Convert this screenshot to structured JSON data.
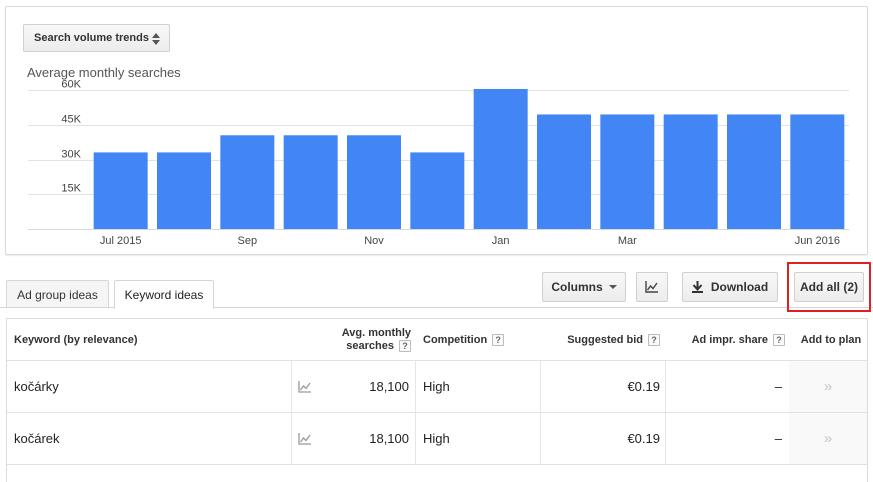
{
  "chart_card": {
    "selector_label": "Search volume trends",
    "title": "Average monthly searches"
  },
  "chart_data": {
    "type": "bar",
    "title": "Average monthly searches",
    "categories": [
      "Jul 2015",
      "Aug 2015",
      "Sep 2015",
      "Oct 2015",
      "Nov 2015",
      "Dec 2015",
      "Jan 2016",
      "Feb 2016",
      "Mar 2016",
      "Apr 2016",
      "May 2016",
      "Jun 2016"
    ],
    "x_tick_labels": [
      "Jul 2015",
      "",
      "Sep",
      "",
      "Nov",
      "",
      "Jan",
      "",
      "Mar",
      "",
      "",
      "Jun 2016"
    ],
    "values": [
      33100,
      33100,
      40500,
      40500,
      40500,
      33100,
      60500,
      49500,
      49500,
      49500,
      49500,
      49500
    ],
    "y_ticks": [
      15000,
      30000,
      45000,
      60000
    ],
    "y_tick_labels": [
      "15K",
      "30K",
      "45K",
      "60K"
    ],
    "ylim": [
      0,
      60500
    ],
    "bar_color": "#4285f4",
    "grid": true
  },
  "tabs": [
    {
      "label": "Ad group ideas",
      "active": false
    },
    {
      "label": "Keyword ideas",
      "active": true
    }
  ],
  "toolbar": {
    "columns_label": "Columns",
    "chart_icon": "line-chart-icon",
    "download_label": "Download",
    "download_icon": "download-icon",
    "add_all_label": "Add all (2)",
    "highlight_color": "#e02020"
  },
  "table": {
    "headers": {
      "keyword": "Keyword (by relevance)",
      "avg_line1": "Avg. monthly",
      "avg_line2": "searches",
      "competition": "Competition",
      "bid": "Suggested bid",
      "impr": "Ad impr. share",
      "plan": "Add to plan",
      "help": "?"
    },
    "rows": [
      {
        "keyword": "kočárky",
        "searches": "18,100",
        "competition": "High",
        "bid": "€0.19",
        "impr_share": "–",
        "plan_icon": "»"
      },
      {
        "keyword": "kočárek",
        "searches": "18,100",
        "competition": "High",
        "bid": "€0.19",
        "impr_share": "–",
        "plan_icon": "»"
      }
    ]
  }
}
